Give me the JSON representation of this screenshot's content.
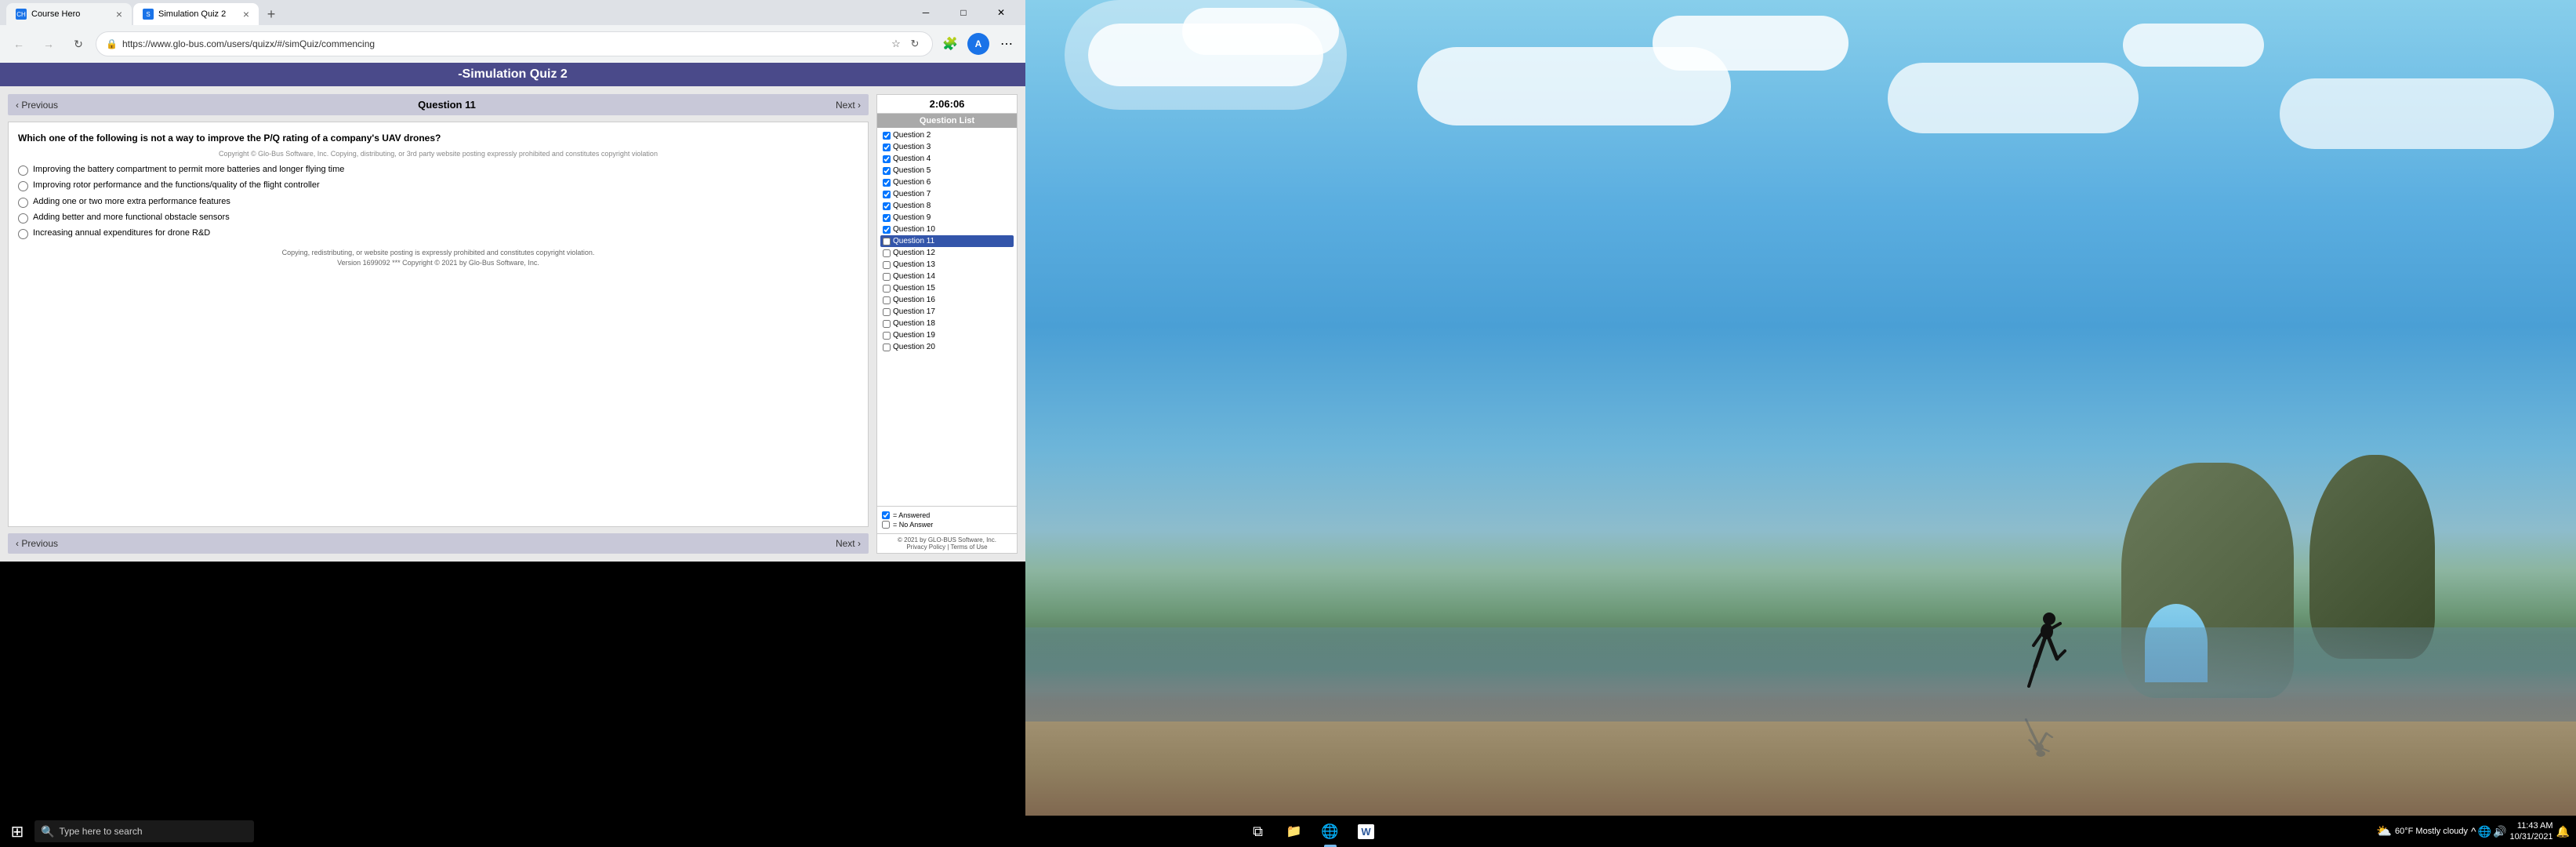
{
  "browser": {
    "tabs": [
      {
        "id": "course-hero",
        "label": "Course Hero",
        "active": false,
        "favicon": "CH"
      },
      {
        "id": "simulation-quiz",
        "label": "Simulation Quiz 2",
        "active": true,
        "favicon": "S"
      }
    ],
    "url": "https://www.glo-bus.com/users/quizx/#/simQuiz/commencing",
    "nav": {
      "back_disabled": true,
      "forward_disabled": true
    }
  },
  "quiz": {
    "title": "-Simulation Quiz 2",
    "timer": "2:06:06",
    "question_number": "Question 11",
    "prev_label": "‹ Previous",
    "next_label": "Next ›",
    "question_text": "Which one of the following is not a way to improve the P/Q rating of a company's UAV drones?",
    "copyright_inline": "Copyright © Glo-Bus Software, Inc. Copying, distributing, or 3rd party website posting expressly prohibited and constitutes copyright violation",
    "answers": [
      {
        "id": "a",
        "text": "Improving the battery compartment to permit more batteries and longer flying time"
      },
      {
        "id": "b",
        "text": "Improving rotor performance and the functions/quality of the flight controller"
      },
      {
        "id": "c",
        "text": "Adding one or two more extra performance features"
      },
      {
        "id": "d",
        "text": "Adding better and more functional obstacle sensors"
      },
      {
        "id": "e",
        "text": "Increasing annual expenditures for drone R&D"
      }
    ],
    "bottom_copyright": "Copying, redistributing, or website posting is expressly prohibited and constitutes copyright violation.\nVersion 1699092 *** Copyright © 2021 by Glo-Bus Software, Inc.",
    "question_list_header": "Question List",
    "questions": [
      {
        "num": "Question 2",
        "answered": true
      },
      {
        "num": "Question 3",
        "answered": true
      },
      {
        "num": "Question 4",
        "answered": true
      },
      {
        "num": "Question 5",
        "answered": true
      },
      {
        "num": "Question 6",
        "answered": true
      },
      {
        "num": "Question 7",
        "answered": true
      },
      {
        "num": "Question 8",
        "answered": true
      },
      {
        "num": "Question 9",
        "answered": true
      },
      {
        "num": "Question 10",
        "answered": true
      },
      {
        "num": "Question 11",
        "answered": false,
        "active": true
      },
      {
        "num": "Question 12",
        "answered": false
      },
      {
        "num": "Question 13",
        "answered": false
      },
      {
        "num": "Question 14",
        "answered": false
      },
      {
        "num": "Question 15",
        "answered": false
      },
      {
        "num": "Question 16",
        "answered": false
      },
      {
        "num": "Question 17",
        "answered": false
      },
      {
        "num": "Question 18",
        "answered": false
      },
      {
        "num": "Question 19",
        "answered": false
      },
      {
        "num": "Question 20",
        "answered": false
      }
    ],
    "legend_answered": "= Answered",
    "legend_no_answer": "= No Answer",
    "footer1": "© 2021 by GLO-BUS Software, Inc.",
    "footer2": "Privacy Policy | Terms of Use"
  },
  "taskbar": {
    "search_placeholder": "Type here to search",
    "time": "11:43 AM",
    "date": "10/31/2021",
    "weather": "60°F  Mostly cloudy",
    "start_icon": "⊞",
    "apps": [
      {
        "name": "task-view",
        "icon": "⧉"
      },
      {
        "name": "file-explorer",
        "icon": "📁"
      },
      {
        "name": "edge",
        "icon": "🌐"
      },
      {
        "name": "word",
        "icon": "W"
      }
    ]
  }
}
